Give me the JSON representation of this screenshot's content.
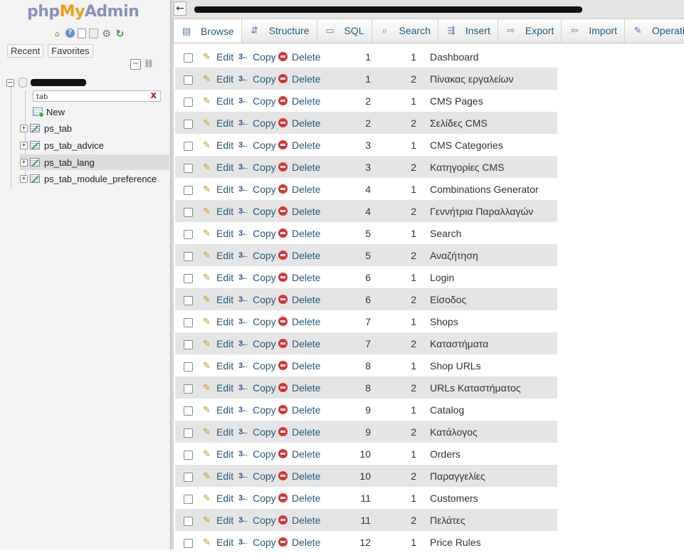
{
  "logo": {
    "part1": "php",
    "part2": "My",
    "part3": "Admin"
  },
  "nav": {
    "recent_label": "Recent",
    "favorites_label": "Favorites",
    "filter": {
      "value": "tab",
      "clear": "X"
    },
    "new_label": "New",
    "tables": [
      {
        "name": "ps_tab",
        "active": false
      },
      {
        "name": "ps_tab_advice",
        "active": false
      },
      {
        "name": "ps_tab_lang",
        "active": true
      },
      {
        "name": "ps_tab_module_preference",
        "active": false
      }
    ]
  },
  "topbar": {
    "back": "←"
  },
  "tabs": [
    {
      "label": "Browse",
      "icon": "browse-icon",
      "active": true
    },
    {
      "label": "Structure",
      "icon": "structure-icon",
      "active": false
    },
    {
      "label": "SQL",
      "icon": "sql-icon",
      "active": false
    },
    {
      "label": "Search",
      "icon": "search-icon",
      "active": false
    },
    {
      "label": "Insert",
      "icon": "insert-icon",
      "active": false
    },
    {
      "label": "Export",
      "icon": "export-icon",
      "active": false
    },
    {
      "label": "Import",
      "icon": "import-icon",
      "active": false
    },
    {
      "label": "Operations",
      "icon": "operations-icon",
      "active": false
    }
  ],
  "actions": {
    "edit": "Edit",
    "copy": "Copy",
    "delete": "Delete"
  },
  "rows": [
    {
      "id_tab": "1",
      "id_lang": "1",
      "name": "Dashboard"
    },
    {
      "id_tab": "1",
      "id_lang": "2",
      "name": "Πίνακας εργαλείων"
    },
    {
      "id_tab": "2",
      "id_lang": "1",
      "name": "CMS Pages"
    },
    {
      "id_tab": "2",
      "id_lang": "2",
      "name": "Σελίδες CMS"
    },
    {
      "id_tab": "3",
      "id_lang": "1",
      "name": "CMS Categories"
    },
    {
      "id_tab": "3",
      "id_lang": "2",
      "name": "Κατηγορίες CMS"
    },
    {
      "id_tab": "4",
      "id_lang": "1",
      "name": "Combinations Generator"
    },
    {
      "id_tab": "4",
      "id_lang": "2",
      "name": "Γεννήτρια Παραλλαγών"
    },
    {
      "id_tab": "5",
      "id_lang": "1",
      "name": "Search"
    },
    {
      "id_tab": "5",
      "id_lang": "2",
      "name": "Αναζήτηση"
    },
    {
      "id_tab": "6",
      "id_lang": "1",
      "name": "Login"
    },
    {
      "id_tab": "6",
      "id_lang": "2",
      "name": "Είσοδος"
    },
    {
      "id_tab": "7",
      "id_lang": "1",
      "name": "Shops"
    },
    {
      "id_tab": "7",
      "id_lang": "2",
      "name": "Καταστήματα"
    },
    {
      "id_tab": "8",
      "id_lang": "1",
      "name": "Shop URLs"
    },
    {
      "id_tab": "8",
      "id_lang": "2",
      "name": "URLs Καταστήματος"
    },
    {
      "id_tab": "9",
      "id_lang": "1",
      "name": "Catalog"
    },
    {
      "id_tab": "9",
      "id_lang": "2",
      "name": "Κατάλογος"
    },
    {
      "id_tab": "10",
      "id_lang": "1",
      "name": "Orders"
    },
    {
      "id_tab": "10",
      "id_lang": "2",
      "name": "Παραγγελίες"
    },
    {
      "id_tab": "11",
      "id_lang": "1",
      "name": "Customers"
    },
    {
      "id_tab": "11",
      "id_lang": "2",
      "name": "Πελάτες"
    },
    {
      "id_tab": "12",
      "id_lang": "1",
      "name": "Price Rules"
    }
  ]
}
